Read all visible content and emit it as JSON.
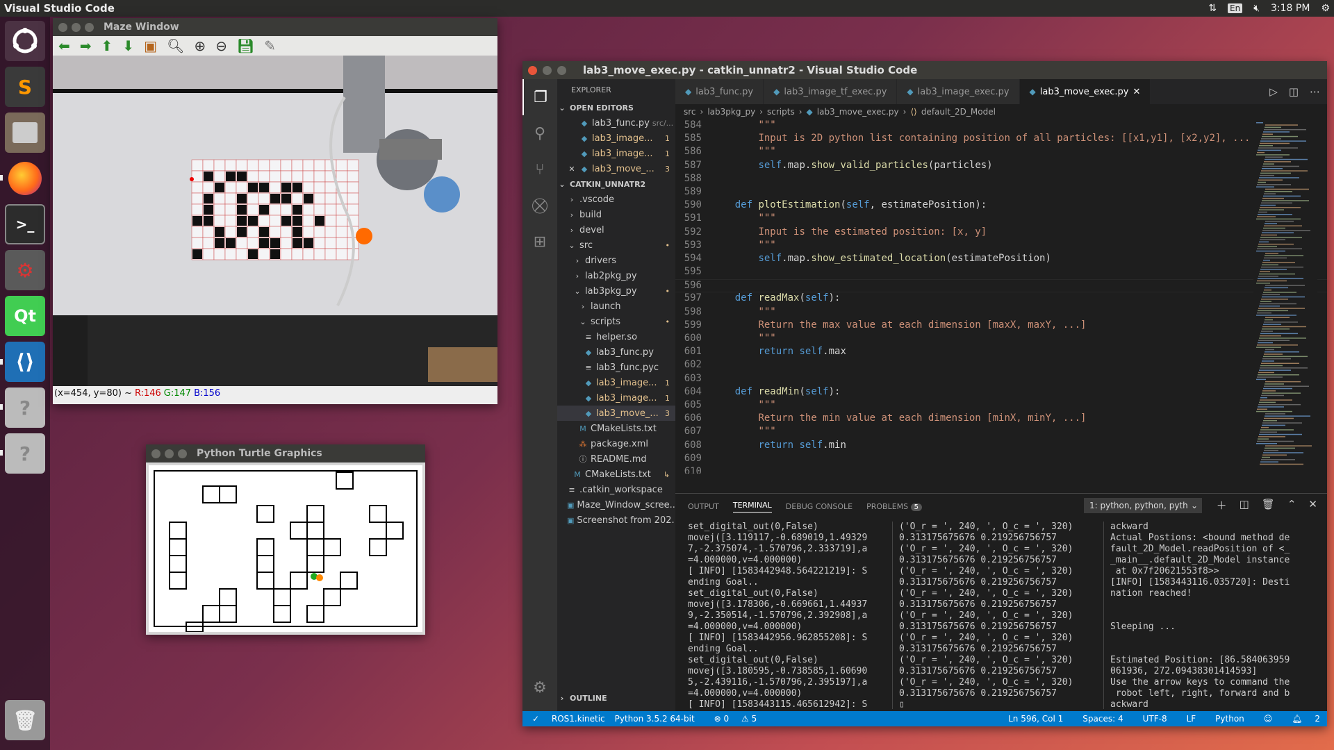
{
  "topbar": {
    "app": "Visual Studio Code",
    "lang": "En",
    "time": "3:18 PM"
  },
  "launcher": {
    "items": [
      "ubuntu-dash",
      "sublime-text",
      "files",
      "firefox",
      "terminal",
      "system-settings",
      "qt-creator",
      "vscode",
      "unknown-app",
      "unknown-app"
    ]
  },
  "maze_window": {
    "title": "Maze Window",
    "status_coords": "(x=454, y=80) ~",
    "r": "R:146",
    "g": "G:147",
    "b": "B:156"
  },
  "turtle_window": {
    "title": "Python Turtle Graphics"
  },
  "vscode": {
    "title": "lab3_move_exec.py - catkin_unnatr2 - Visual Studio Code",
    "explorer": {
      "header": "EXPLORER",
      "open_editors": "OPEN EDITORS",
      "workspace": "CATKIN_UNNATR2",
      "outline": "OUTLINE",
      "open_files": [
        {
          "name": "lab3_func.py",
          "extra": "src/...",
          "count": ""
        },
        {
          "name": "lab3_image...",
          "extra": "",
          "count": "1"
        },
        {
          "name": "lab3_image...",
          "extra": "",
          "count": "1"
        },
        {
          "name": "lab3_move_...",
          "extra": "",
          "count": "3"
        }
      ],
      "tree": [
        {
          "name": ".vscode",
          "indent": 1,
          "icon": "›",
          "count": ""
        },
        {
          "name": "build",
          "indent": 1,
          "icon": "›",
          "count": ""
        },
        {
          "name": "devel",
          "indent": 1,
          "icon": "›",
          "count": ""
        },
        {
          "name": "src",
          "indent": 1,
          "icon": "⌄",
          "count": "•"
        },
        {
          "name": "drivers",
          "indent": 2,
          "icon": "›",
          "count": ""
        },
        {
          "name": "lab2pkg_py",
          "indent": 2,
          "icon": "›",
          "count": ""
        },
        {
          "name": "lab3pkg_py",
          "indent": 2,
          "icon": "⌄",
          "count": "•"
        },
        {
          "name": "launch",
          "indent": 3,
          "icon": "›",
          "count": ""
        },
        {
          "name": "scripts",
          "indent": 3,
          "icon": "⌄",
          "count": "•"
        },
        {
          "name": "helper.so",
          "indent": 4,
          "icon": "≡",
          "count": ""
        },
        {
          "name": "lab3_func.py",
          "indent": 4,
          "icon": "◆",
          "count": ""
        },
        {
          "name": "lab3_func.pyc",
          "indent": 4,
          "icon": "≡",
          "count": ""
        },
        {
          "name": "lab3_image...",
          "indent": 4,
          "icon": "◆",
          "count": "1"
        },
        {
          "name": "lab3_image...",
          "indent": 4,
          "icon": "◆",
          "count": "1"
        },
        {
          "name": "lab3_move_...",
          "indent": 4,
          "icon": "◆",
          "count": "3"
        },
        {
          "name": "CMakeLists.txt",
          "indent": 3,
          "icon": "M",
          "count": ""
        },
        {
          "name": "package.xml",
          "indent": 3,
          "icon": "⁂",
          "count": ""
        },
        {
          "name": "README.md",
          "indent": 3,
          "icon": "ⓘ",
          "count": ""
        },
        {
          "name": "CMakeLists.txt",
          "indent": 2,
          "icon": "M",
          "count": "↳"
        },
        {
          "name": ".catkin_workspace",
          "indent": 1,
          "icon": "≡",
          "count": ""
        },
        {
          "name": "Maze_Window_scree...",
          "indent": 1,
          "icon": "▣",
          "count": ""
        },
        {
          "name": "Screenshot from 202...",
          "indent": 1,
          "icon": "▣",
          "count": ""
        }
      ]
    },
    "tabs": [
      "lab3_func.py",
      "lab3_image_tf_exec.py",
      "lab3_image_exec.py",
      "lab3_move_exec.py"
    ],
    "breadcrumb": [
      "src",
      "lab3pkg_py",
      "scripts",
      "lab3_move_exec.py",
      "default_2D_Model"
    ],
    "code": [
      {
        "n": "584",
        "t": [
          [
            "",
            "        "
          ],
          [
            "s",
            "\"\"\""
          ]
        ]
      },
      {
        "n": "585",
        "t": [
          [
            "",
            "        "
          ],
          [
            "s",
            "Input is 2D python list containing position of all particles: [[x1,y1], [x2,y2], ..."
          ]
        ]
      },
      {
        "n": "586",
        "t": [
          [
            "",
            "        "
          ],
          [
            "s",
            "\"\"\""
          ]
        ]
      },
      {
        "n": "587",
        "t": [
          [
            "",
            "        "
          ],
          [
            "k",
            "self"
          ],
          [
            "",
            ".map."
          ],
          [
            "f",
            "show_valid_particles"
          ],
          [
            "",
            "(particles)"
          ]
        ]
      },
      {
        "n": "588",
        "t": []
      },
      {
        "n": "589",
        "t": []
      },
      {
        "n": "590",
        "t": [
          [
            "",
            "    "
          ],
          [
            "k",
            "def "
          ],
          [
            "f",
            "plotEstimation"
          ],
          [
            "",
            "("
          ],
          [
            "k",
            "self"
          ],
          [
            "",
            ", estimatePosition):"
          ]
        ]
      },
      {
        "n": "591",
        "t": [
          [
            "",
            "        "
          ],
          [
            "s",
            "\"\"\""
          ]
        ]
      },
      {
        "n": "592",
        "t": [
          [
            "",
            "        "
          ],
          [
            "s",
            "Input is the estimated position: [x, y]"
          ]
        ]
      },
      {
        "n": "593",
        "t": [
          [
            "",
            "        "
          ],
          [
            "s",
            "\"\"\""
          ]
        ]
      },
      {
        "n": "594",
        "t": [
          [
            "",
            "        "
          ],
          [
            "k",
            "self"
          ],
          [
            "",
            ".map."
          ],
          [
            "f",
            "show_estimated_location"
          ],
          [
            "",
            "(estimatePosition)"
          ]
        ]
      },
      {
        "n": "595",
        "t": []
      },
      {
        "n": "596",
        "t": []
      },
      {
        "n": "597",
        "t": [
          [
            "",
            "    "
          ],
          [
            "k",
            "def "
          ],
          [
            "f",
            "readMax"
          ],
          [
            "",
            "("
          ],
          [
            "k",
            "self"
          ],
          [
            "",
            "):"
          ]
        ]
      },
      {
        "n": "598",
        "t": [
          [
            "",
            "        "
          ],
          [
            "s",
            "\"\"\""
          ]
        ]
      },
      {
        "n": "599",
        "t": [
          [
            "",
            "        "
          ],
          [
            "s",
            "Return the max value at each dimension [maxX, maxY, ...]"
          ]
        ]
      },
      {
        "n": "600",
        "t": [
          [
            "",
            "        "
          ],
          [
            "s",
            "\"\"\""
          ]
        ]
      },
      {
        "n": "601",
        "t": [
          [
            "",
            "        "
          ],
          [
            "k",
            "return "
          ],
          [
            "k",
            "self"
          ],
          [
            "",
            ".max"
          ]
        ]
      },
      {
        "n": "602",
        "t": []
      },
      {
        "n": "603",
        "t": []
      },
      {
        "n": "604",
        "t": [
          [
            "",
            "    "
          ],
          [
            "k",
            "def "
          ],
          [
            "f",
            "readMin"
          ],
          [
            "",
            "("
          ],
          [
            "k",
            "self"
          ],
          [
            "",
            "):"
          ]
        ]
      },
      {
        "n": "605",
        "t": [
          [
            "",
            "        "
          ],
          [
            "s",
            "\"\"\""
          ]
        ]
      },
      {
        "n": "606",
        "t": [
          [
            "",
            "        "
          ],
          [
            "s",
            "Return the min value at each dimension [minX, minY, ...]"
          ]
        ]
      },
      {
        "n": "607",
        "t": [
          [
            "",
            "        "
          ],
          [
            "s",
            "\"\"\""
          ]
        ]
      },
      {
        "n": "608",
        "t": [
          [
            "",
            "        "
          ],
          [
            "k",
            "return "
          ],
          [
            "k",
            "self"
          ],
          [
            "",
            ".min"
          ]
        ]
      },
      {
        "n": "609",
        "t": []
      },
      {
        "n": "610",
        "t": []
      }
    ],
    "panel": {
      "tabs": [
        "OUTPUT",
        "TERMINAL",
        "DEBUG CONSOLE",
        "PROBLEMS"
      ],
      "problems_count": "5",
      "selector": "1: python, python, pyth",
      "term1": "set_digital_out(0,False)\nmovej([3.119117,-0.689019,1.49329\n7,-2.375074,-1.570796,2.333719],a\n=4.000000,v=4.000000)\n[ INFO] [1583442948.564221219]: S\nending Goal..\nset_digital_out(0,False)\nmovej([3.178306,-0.669661,1.44937\n9,-2.350514,-1.570796,2.392908],a\n=4.000000,v=4.000000)\n[ INFO] [1583442956.962855208]: S\nending Goal..\nset_digital_out(0,False)\nmovej([3.180595,-0.738585,1.60690\n5,-2.439116,-1.570796,2.395197],a\n=4.000000,v=4.000000)\n[ INFO] [1583443115.465612942]: S\nending Goal..\n▯",
      "term2": "('O_r = ', 240, ', O_c = ', 320)\n0.313175675676 0.219256756757\n('O_r = ', 240, ', O_c = ', 320)\n0.313175675676 0.219256756757\n('O_r = ', 240, ', O_c = ', 320)\n0.313175675676 0.219256756757\n('O_r = ', 240, ', O_c = ', 320)\n0.313175675676 0.219256756757\n('O_r = ', 240, ', O_c = ', 320)\n0.313175675676 0.219256756757\n('O_r = ', 240, ', O_c = ', 320)\n0.313175675676 0.219256756757\n('O_r = ', 240, ', O_c = ', 320)\n0.313175675676 0.219256756757\n('O_r = ', 240, ', O_c = ', 320)\n0.313175675676 0.219256756757\n▯",
      "term3": "ackward\nActual Postions: <bound method de\nfault_2D_Model.readPosition of <_\n_main__.default_2D_Model instance\n at 0x7f20621553f8>>\n[INFO] [1583443116.035720]: Desti\nnation reached!\n\n\nSleeping ...\n\n\nEstimated Position: [86.584063959\n061936, 272.09438301414593]\nUse the arrow keys to command the\n robot left, right, forward and b\nackward\n▮"
    },
    "status": {
      "branch": "ROS1.kinetic",
      "python": "Python 3.5.2 64-bit",
      "errors": "⊗ 0",
      "warnings": "⚠ 5",
      "pos": "Ln 596, Col 1",
      "spaces": "Spaces: 4",
      "enc": "UTF-8",
      "eol": "LF",
      "lang": "Python",
      "notif": "2"
    }
  }
}
